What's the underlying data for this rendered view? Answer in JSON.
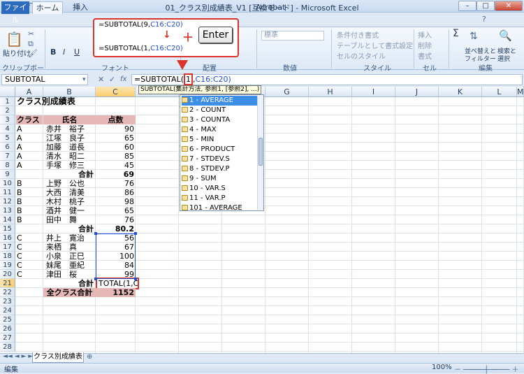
{
  "window": {
    "title": "01_クラス別成績表_V1 [互換モード] - Microsoft Excel"
  },
  "qat": {
    "undo": "↶",
    "redo": "↷"
  },
  "tabs": {
    "file": "ファイル",
    "home": "ホーム",
    "insert": "挿入",
    "acrobat": "Acrobat"
  },
  "ribbon": {
    "paste": "貼り付け",
    "groups": {
      "clipboard": "クリップボード",
      "font": "フォント",
      "alignment": "配置",
      "number": "数値",
      "styles": "スタイル",
      "cells": "セル",
      "editing": "編集"
    },
    "number_format": "標準",
    "conditional_format": "条件付き書式",
    "table_format": "テーブルとして書式設定",
    "cell_styles": "セルのスタイル",
    "insert": "挿入",
    "delete": "削除",
    "format": "書式",
    "sort_filter_1": "並べ替えと",
    "sort_filter_2": "フィルター",
    "find_select_1": "検索と",
    "find_select_2": "選択",
    "sigma": "Σ"
  },
  "callout": {
    "line1_a": "=SUBTOTAL(9,",
    "line1_b": "C16:C20)",
    "line2_a": "=SUBTOTAL(1,",
    "line2_b": "C16:C20)",
    "arrow": "↓",
    "plus": "＋",
    "key": "Enter"
  },
  "formula_bar": {
    "name_box": "SUBTOTAL",
    "cancel": "✕",
    "enter": "✓",
    "fx": "fx",
    "formula_a": "=SUBTOTAL(",
    "formula_sel": "1",
    "formula_b": ",",
    "formula_ref": "C16:C20)",
    "hint": "SUBTOTAL(集計方法, 参照1, [参照2], ...)"
  },
  "columns": [
    "A",
    "B",
    "C",
    "D",
    "E",
    "F",
    "G",
    "H",
    "I",
    "J",
    "K",
    "L",
    "M"
  ],
  "rows": [
    "1",
    "2",
    "3",
    "4",
    "5",
    "6",
    "7",
    "8",
    "9",
    "10",
    "11",
    "12",
    "13",
    "14",
    "15",
    "16",
    "17",
    "18",
    "19",
    "20",
    "21",
    "22",
    "23",
    "24",
    "25",
    "26",
    "27",
    "28"
  ],
  "sheet": {
    "title": "クラス別成績表",
    "headers": {
      "class": "クラス",
      "name": "氏名",
      "score": "点数"
    },
    "rows": [
      {
        "class": "A",
        "name": "赤井　裕子",
        "score": "90"
      },
      {
        "class": "A",
        "name": "江塚　良子",
        "score": "65"
      },
      {
        "class": "A",
        "name": "加藤　道長",
        "score": "60"
      },
      {
        "class": "A",
        "name": "清水　昭二",
        "score": "85"
      },
      {
        "class": "A",
        "name": "手塚　修三",
        "score": "45"
      },
      {
        "class": "",
        "name": "合計",
        "score": "69"
      },
      {
        "class": "B",
        "name": "上野　公也",
        "score": "76"
      },
      {
        "class": "B",
        "name": "大西　清美",
        "score": "86"
      },
      {
        "class": "B",
        "name": "木村　桃子",
        "score": "98"
      },
      {
        "class": "B",
        "name": "酒井　健一",
        "score": "65"
      },
      {
        "class": "B",
        "name": "田中　舞",
        "score": "76"
      },
      {
        "class": "",
        "name": "合計",
        "score": "80.2"
      },
      {
        "class": "C",
        "name": "井上　寛治",
        "score": "56"
      },
      {
        "class": "C",
        "name": "来栖　真",
        "score": "67"
      },
      {
        "class": "C",
        "name": "小泉　正巳",
        "score": "100"
      },
      {
        "class": "C",
        "name": "妹尾　亜紀",
        "score": "84"
      },
      {
        "class": "C",
        "name": "津田　桜",
        "score": "99"
      },
      {
        "class": "",
        "name": "合計",
        "score": "TOTAL(1,C"
      },
      {
        "class": "",
        "name": "全クラス合計",
        "score": "1152"
      }
    ]
  },
  "autocomplete": {
    "items": [
      "1 - AVERAGE",
      "2 - COUNT",
      "3 - COUNTA",
      "4 - MAX",
      "5 - MIN",
      "6 - PRODUCT",
      "7 - STDEV.S",
      "8 - STDEV.P",
      "9 - SUM",
      "10 - VAR.S",
      "11 - VAR.P",
      "101 - AVERAGE"
    ]
  },
  "sheet_tabs": {
    "active": "クラス別成績表"
  },
  "status": {
    "mode": "編集",
    "zoom": "100%"
  },
  "colors": {
    "accent_red": "#d9332b",
    "header_fill": "#e5b8b7",
    "ref_blue": "#1f4ed6"
  }
}
